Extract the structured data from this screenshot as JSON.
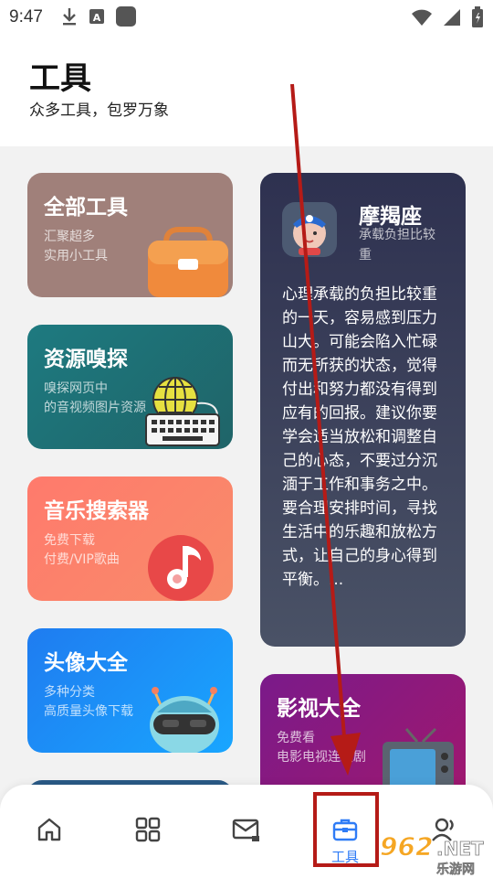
{
  "status_bar": {
    "time": "9:47",
    "left_icons": [
      "download-icon",
      "font-icon",
      "app-icon"
    ],
    "right_icons": [
      "wifi-icon",
      "signal-icon",
      "battery-icon"
    ]
  },
  "header": {
    "title": "工具",
    "subtitle": "众多工具，包罗万象"
  },
  "cards": {
    "tools": {
      "title": "全部工具",
      "desc_line1": "汇聚超多",
      "desc_line2": "实用小工具",
      "color": "#a0807a",
      "icon": "toolbox-icon"
    },
    "sniff": {
      "title": "资源嗅探",
      "desc_line1": "嗅探网页中",
      "desc_line2": "的音视频图片资源",
      "color": "#1f6f74",
      "icon": "globe-keyboard-icon"
    },
    "music": {
      "title": "音乐搜索器",
      "desc_line1": "免费下载",
      "desc_line2": "付费/VIP歌曲",
      "color": "#ff7a6c",
      "icon": "music-note-icon"
    },
    "avatar": {
      "title": "头像大全",
      "desc_line1": "多种分类",
      "desc_line2": "高质量头像下载",
      "color": "#1f8cf5",
      "icon": "robot-icon"
    },
    "zodiac": {
      "name": "摩羯座",
      "sub_line1": "承载负担比较",
      "sub_line2": "重",
      "body": "心理承载的负担比较重的一天，容易感到压力山大。可能会陷入忙碌而无所获的状态，觉得付出和努力都没有得到应有的回报。建议你要学会适当放松和调整自己的心态，不要过分沉湎于工作和事务之中。要合理安排时间，寻找生活中的乐趣和放松方式，让自己的身心得到平衡。...",
      "icon": "capricorn-avatar-icon"
    },
    "video": {
      "title": "影视大全",
      "desc_line1": "免费看",
      "desc_line2": "电影电视连续剧",
      "color": "#8a1a80",
      "icon": "tv-icon"
    }
  },
  "bottom_nav": {
    "items": [
      {
        "icon": "home-icon",
        "label": ""
      },
      {
        "icon": "apps-grid-icon",
        "label": ""
      },
      {
        "icon": "mail-icon",
        "label": ""
      },
      {
        "icon": "toolbox-icon",
        "label": "工具"
      },
      {
        "icon": "profile-icon",
        "label": ""
      }
    ],
    "active_color": "#2f7cf6"
  },
  "watermark": {
    "line1": "962.NET",
    "line2": "乐游网"
  },
  "annotation_color": "#b51b17"
}
